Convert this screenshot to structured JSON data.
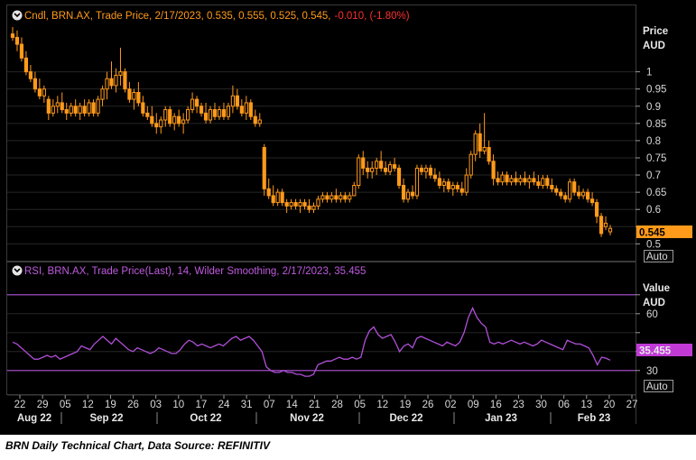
{
  "caption": "BRN Daily Technical Chart, Data Source: REFINITIV",
  "colors": {
    "background": "#000000",
    "candle": "#ff9a1a",
    "rsi_line": "#b04fd8",
    "rsi_band": "#b04fd8",
    "down_change": "#ff3030",
    "rsi_last_badge": "#c13ad6",
    "price_last_badge": "#ff9a1a",
    "grid": "#262626",
    "axis_text": "#d8d8d8"
  },
  "price_panel": {
    "legend_icon": "chart-settings-icon",
    "legend_prefix": "Cndl, BRN.AX, Trade Price, 2/17/2023, 0.535, 0.555, 0.525, 0.545,",
    "legend_change": "-0.010, (-1.80%)",
    "axis_title_1": "Price",
    "axis_title_2": "AUD",
    "last_value_label": "0.545",
    "scale_button": "Auto"
  },
  "rsi_panel": {
    "legend_icon": "chart-settings-icon",
    "legend_text": "RSI, BRN.AX, Trade Price(Last),  14, Wilder Smoothing, 2/17/2023, 35.455",
    "axis_title_1": "Value",
    "axis_title_2": "AUD",
    "last_value_label": "35.455",
    "scale_button": "Auto"
  },
  "chart_data": [
    {
      "type": "candlestick",
      "title": "Cndl, BRN.AX, Trade Price",
      "ylabel": "Price AUD",
      "ylim": [
        0.48,
        1.13
      ],
      "y_ticks": [
        0.5,
        0.55,
        0.6,
        0.65,
        0.7,
        0.75,
        0.8,
        0.85,
        0.9,
        0.95,
        1
      ],
      "y_tick_labels": [
        "0.5",
        "",
        "0.6",
        "0.65",
        "0.7",
        "0.75",
        "0.8",
        "0.85",
        "0.9",
        "0.95",
        "1"
      ],
      "last_close": 0.545,
      "x_day_ticks": [
        "22",
        "29",
        "05",
        "12",
        "19",
        "26",
        "03",
        "10",
        "17",
        "24",
        "31",
        "07",
        "14",
        "21",
        "28",
        "05",
        "12",
        "19",
        "26",
        "02",
        "09",
        "16",
        "23",
        "30",
        "06",
        "13",
        "20",
        "27"
      ],
      "x_month_labels": [
        "Aug 22",
        "Sep 22",
        "Oct 22",
        "Nov 22",
        "Dec 22",
        "Jan 23",
        "Feb 23"
      ],
      "candles": [
        {
          "o": 1.11,
          "h": 1.13,
          "l": 1.09,
          "c": 1.1
        },
        {
          "o": 1.1,
          "h": 1.12,
          "l": 1.06,
          "c": 1.08
        },
        {
          "o": 1.08,
          "h": 1.1,
          "l": 1.03,
          "c": 1.04
        },
        {
          "o": 1.04,
          "h": 1.06,
          "l": 0.99,
          "c": 1.0
        },
        {
          "o": 1.0,
          "h": 1.02,
          "l": 0.97,
          "c": 0.98
        },
        {
          "o": 0.98,
          "h": 1.0,
          "l": 0.94,
          "c": 0.95
        },
        {
          "o": 0.95,
          "h": 0.98,
          "l": 0.92,
          "c": 0.93
        },
        {
          "o": 0.93,
          "h": 0.96,
          "l": 0.91,
          "c": 0.95
        },
        {
          "o": 0.92,
          "h": 0.93,
          "l": 0.86,
          "c": 0.88
        },
        {
          "o": 0.88,
          "h": 0.92,
          "l": 0.87,
          "c": 0.9
        },
        {
          "o": 0.9,
          "h": 0.93,
          "l": 0.88,
          "c": 0.91
        },
        {
          "o": 0.91,
          "h": 0.94,
          "l": 0.88,
          "c": 0.89
        },
        {
          "o": 0.89,
          "h": 0.91,
          "l": 0.86,
          "c": 0.88
        },
        {
          "o": 0.88,
          "h": 0.91,
          "l": 0.87,
          "c": 0.9
        },
        {
          "o": 0.9,
          "h": 0.92,
          "l": 0.87,
          "c": 0.88
        },
        {
          "o": 0.88,
          "h": 0.91,
          "l": 0.86,
          "c": 0.9
        },
        {
          "o": 0.9,
          "h": 0.92,
          "l": 0.87,
          "c": 0.88
        },
        {
          "o": 0.88,
          "h": 0.92,
          "l": 0.87,
          "c": 0.91
        },
        {
          "o": 0.91,
          "h": 0.92,
          "l": 0.87,
          "c": 0.88
        },
        {
          "o": 0.88,
          "h": 0.93,
          "l": 0.87,
          "c": 0.92
        },
        {
          "o": 0.92,
          "h": 0.96,
          "l": 0.9,
          "c": 0.95
        },
        {
          "o": 0.95,
          "h": 1.0,
          "l": 0.92,
          "c": 0.98
        },
        {
          "o": 0.98,
          "h": 1.03,
          "l": 0.95,
          "c": 0.96
        },
        {
          "o": 0.96,
          "h": 1.01,
          "l": 0.94,
          "c": 0.99
        },
        {
          "o": 0.99,
          "h": 1.07,
          "l": 0.96,
          "c": 1.0
        },
        {
          "o": 1.0,
          "h": 1.01,
          "l": 0.94,
          "c": 0.95
        },
        {
          "o": 0.95,
          "h": 0.97,
          "l": 0.91,
          "c": 0.92
        },
        {
          "o": 0.92,
          "h": 0.95,
          "l": 0.89,
          "c": 0.94
        },
        {
          "o": 0.94,
          "h": 0.97,
          "l": 0.9,
          "c": 0.91
        },
        {
          "o": 0.91,
          "h": 0.93,
          "l": 0.87,
          "c": 0.88
        },
        {
          "o": 0.88,
          "h": 0.9,
          "l": 0.86,
          "c": 0.87
        },
        {
          "o": 0.87,
          "h": 0.9,
          "l": 0.84,
          "c": 0.85
        },
        {
          "o": 0.85,
          "h": 0.88,
          "l": 0.82,
          "c": 0.84
        },
        {
          "o": 0.84,
          "h": 0.87,
          "l": 0.82,
          "c": 0.86
        },
        {
          "o": 0.86,
          "h": 0.9,
          "l": 0.84,
          "c": 0.89
        },
        {
          "o": 0.89,
          "h": 0.9,
          "l": 0.84,
          "c": 0.85
        },
        {
          "o": 0.85,
          "h": 0.88,
          "l": 0.83,
          "c": 0.87
        },
        {
          "o": 0.87,
          "h": 0.89,
          "l": 0.84,
          "c": 0.85
        },
        {
          "o": 0.85,
          "h": 0.88,
          "l": 0.82,
          "c": 0.86
        },
        {
          "o": 0.86,
          "h": 0.9,
          "l": 0.85,
          "c": 0.89
        },
        {
          "o": 0.89,
          "h": 0.94,
          "l": 0.88,
          "c": 0.92
        },
        {
          "o": 0.92,
          "h": 0.93,
          "l": 0.88,
          "c": 0.9
        },
        {
          "o": 0.9,
          "h": 0.91,
          "l": 0.87,
          "c": 0.88
        },
        {
          "o": 0.88,
          "h": 0.91,
          "l": 0.85,
          "c": 0.86
        },
        {
          "o": 0.86,
          "h": 0.9,
          "l": 0.85,
          "c": 0.89
        },
        {
          "o": 0.89,
          "h": 0.91,
          "l": 0.86,
          "c": 0.87
        },
        {
          "o": 0.87,
          "h": 0.9,
          "l": 0.86,
          "c": 0.89
        },
        {
          "o": 0.89,
          "h": 0.91,
          "l": 0.86,
          "c": 0.87
        },
        {
          "o": 0.87,
          "h": 0.91,
          "l": 0.86,
          "c": 0.9
        },
        {
          "o": 0.9,
          "h": 0.96,
          "l": 0.88,
          "c": 0.93
        },
        {
          "o": 0.93,
          "h": 0.95,
          "l": 0.89,
          "c": 0.9
        },
        {
          "o": 0.9,
          "h": 0.92,
          "l": 0.87,
          "c": 0.88
        },
        {
          "o": 0.88,
          "h": 0.93,
          "l": 0.86,
          "c": 0.91
        },
        {
          "o": 0.91,
          "h": 0.92,
          "l": 0.86,
          "c": 0.87
        },
        {
          "o": 0.87,
          "h": 0.89,
          "l": 0.84,
          "c": 0.85
        },
        {
          "o": 0.85,
          "h": 0.88,
          "l": 0.84,
          "c": 0.86
        },
        {
          "o": 0.78,
          "h": 0.79,
          "l": 0.64,
          "c": 0.66
        },
        {
          "o": 0.66,
          "h": 0.69,
          "l": 0.63,
          "c": 0.64
        },
        {
          "o": 0.64,
          "h": 0.67,
          "l": 0.61,
          "c": 0.62
        },
        {
          "o": 0.62,
          "h": 0.66,
          "l": 0.61,
          "c": 0.65
        },
        {
          "o": 0.65,
          "h": 0.66,
          "l": 0.61,
          "c": 0.62
        },
        {
          "o": 0.62,
          "h": 0.63,
          "l": 0.59,
          "c": 0.61
        },
        {
          "o": 0.61,
          "h": 0.63,
          "l": 0.6,
          "c": 0.62
        },
        {
          "o": 0.62,
          "h": 0.63,
          "l": 0.6,
          "c": 0.61
        },
        {
          "o": 0.61,
          "h": 0.63,
          "l": 0.59,
          "c": 0.62
        },
        {
          "o": 0.62,
          "h": 0.63,
          "l": 0.6,
          "c": 0.61
        },
        {
          "o": 0.61,
          "h": 0.63,
          "l": 0.59,
          "c": 0.6
        },
        {
          "o": 0.6,
          "h": 0.62,
          "l": 0.59,
          "c": 0.61
        },
        {
          "o": 0.61,
          "h": 0.64,
          "l": 0.6,
          "c": 0.63
        },
        {
          "o": 0.63,
          "h": 0.65,
          "l": 0.62,
          "c": 0.64
        },
        {
          "o": 0.64,
          "h": 0.65,
          "l": 0.62,
          "c": 0.63
        },
        {
          "o": 0.63,
          "h": 0.65,
          "l": 0.62,
          "c": 0.64
        },
        {
          "o": 0.64,
          "h": 0.66,
          "l": 0.62,
          "c": 0.63
        },
        {
          "o": 0.63,
          "h": 0.65,
          "l": 0.62,
          "c": 0.64
        },
        {
          "o": 0.64,
          "h": 0.65,
          "l": 0.62,
          "c": 0.63
        },
        {
          "o": 0.63,
          "h": 0.65,
          "l": 0.62,
          "c": 0.64
        },
        {
          "o": 0.64,
          "h": 0.68,
          "l": 0.64,
          "c": 0.67
        },
        {
          "o": 0.67,
          "h": 0.76,
          "l": 0.66,
          "c": 0.75
        },
        {
          "o": 0.75,
          "h": 0.77,
          "l": 0.7,
          "c": 0.72
        },
        {
          "o": 0.72,
          "h": 0.74,
          "l": 0.69,
          "c": 0.71
        },
        {
          "o": 0.71,
          "h": 0.74,
          "l": 0.69,
          "c": 0.72
        },
        {
          "o": 0.72,
          "h": 0.75,
          "l": 0.7,
          "c": 0.74
        },
        {
          "o": 0.74,
          "h": 0.77,
          "l": 0.71,
          "c": 0.72
        },
        {
          "o": 0.72,
          "h": 0.74,
          "l": 0.7,
          "c": 0.71
        },
        {
          "o": 0.71,
          "h": 0.74,
          "l": 0.7,
          "c": 0.73
        },
        {
          "o": 0.73,
          "h": 0.75,
          "l": 0.71,
          "c": 0.72
        },
        {
          "o": 0.72,
          "h": 0.73,
          "l": 0.66,
          "c": 0.67
        },
        {
          "o": 0.67,
          "h": 0.69,
          "l": 0.62,
          "c": 0.63
        },
        {
          "o": 0.63,
          "h": 0.66,
          "l": 0.62,
          "c": 0.65
        },
        {
          "o": 0.65,
          "h": 0.67,
          "l": 0.63,
          "c": 0.64
        },
        {
          "o": 0.64,
          "h": 0.73,
          "l": 0.63,
          "c": 0.72
        },
        {
          "o": 0.72,
          "h": 0.73,
          "l": 0.7,
          "c": 0.71
        },
        {
          "o": 0.71,
          "h": 0.73,
          "l": 0.69,
          "c": 0.72
        },
        {
          "o": 0.72,
          "h": 0.73,
          "l": 0.69,
          "c": 0.7
        },
        {
          "o": 0.7,
          "h": 0.72,
          "l": 0.68,
          "c": 0.69
        },
        {
          "o": 0.69,
          "h": 0.71,
          "l": 0.66,
          "c": 0.67
        },
        {
          "o": 0.67,
          "h": 0.69,
          "l": 0.65,
          "c": 0.68
        },
        {
          "o": 0.68,
          "h": 0.69,
          "l": 0.65,
          "c": 0.66
        },
        {
          "o": 0.66,
          "h": 0.68,
          "l": 0.64,
          "c": 0.67
        },
        {
          "o": 0.67,
          "h": 0.68,
          "l": 0.65,
          "c": 0.66
        },
        {
          "o": 0.66,
          "h": 0.68,
          "l": 0.64,
          "c": 0.65
        },
        {
          "o": 0.65,
          "h": 0.72,
          "l": 0.64,
          "c": 0.7
        },
        {
          "o": 0.7,
          "h": 0.77,
          "l": 0.69,
          "c": 0.76
        },
        {
          "o": 0.76,
          "h": 0.83,
          "l": 0.74,
          "c": 0.82
        },
        {
          "o": 0.82,
          "h": 0.85,
          "l": 0.75,
          "c": 0.77
        },
        {
          "o": 0.77,
          "h": 0.88,
          "l": 0.76,
          "c": 0.78
        },
        {
          "o": 0.78,
          "h": 0.8,
          "l": 0.73,
          "c": 0.74
        },
        {
          "o": 0.74,
          "h": 0.76,
          "l": 0.67,
          "c": 0.69
        },
        {
          "o": 0.69,
          "h": 0.71,
          "l": 0.67,
          "c": 0.68
        },
        {
          "o": 0.68,
          "h": 0.71,
          "l": 0.67,
          "c": 0.7
        },
        {
          "o": 0.7,
          "h": 0.71,
          "l": 0.67,
          "c": 0.68
        },
        {
          "o": 0.68,
          "h": 0.7,
          "l": 0.67,
          "c": 0.69
        },
        {
          "o": 0.69,
          "h": 0.71,
          "l": 0.67,
          "c": 0.68
        },
        {
          "o": 0.68,
          "h": 0.7,
          "l": 0.67,
          "c": 0.69
        },
        {
          "o": 0.69,
          "h": 0.71,
          "l": 0.67,
          "c": 0.68
        },
        {
          "o": 0.68,
          "h": 0.7,
          "l": 0.66,
          "c": 0.69
        },
        {
          "o": 0.69,
          "h": 0.71,
          "l": 0.67,
          "c": 0.68
        },
        {
          "o": 0.68,
          "h": 0.7,
          "l": 0.66,
          "c": 0.67
        },
        {
          "o": 0.67,
          "h": 0.7,
          "l": 0.66,
          "c": 0.69
        },
        {
          "o": 0.69,
          "h": 0.7,
          "l": 0.66,
          "c": 0.67
        },
        {
          "o": 0.67,
          "h": 0.69,
          "l": 0.65,
          "c": 0.66
        },
        {
          "o": 0.66,
          "h": 0.67,
          "l": 0.64,
          "c": 0.65
        },
        {
          "o": 0.65,
          "h": 0.66,
          "l": 0.63,
          "c": 0.64
        },
        {
          "o": 0.64,
          "h": 0.65,
          "l": 0.62,
          "c": 0.63
        },
        {
          "o": 0.63,
          "h": 0.69,
          "l": 0.62,
          "c": 0.68
        },
        {
          "o": 0.68,
          "h": 0.69,
          "l": 0.64,
          "c": 0.65
        },
        {
          "o": 0.65,
          "h": 0.67,
          "l": 0.63,
          "c": 0.64
        },
        {
          "o": 0.64,
          "h": 0.66,
          "l": 0.63,
          "c": 0.65
        },
        {
          "o": 0.65,
          "h": 0.66,
          "l": 0.62,
          "c": 0.63
        },
        {
          "o": 0.63,
          "h": 0.65,
          "l": 0.61,
          "c": 0.62
        },
        {
          "o": 0.62,
          "h": 0.63,
          "l": 0.56,
          "c": 0.58
        },
        {
          "o": 0.58,
          "h": 0.59,
          "l": 0.52,
          "c": 0.53
        },
        {
          "o": 0.55,
          "h": 0.58,
          "l": 0.54,
          "c": 0.56
        },
        {
          "o": 0.535,
          "h": 0.555,
          "l": 0.525,
          "c": 0.545
        }
      ]
    },
    {
      "type": "line",
      "title": "RSI, BRN.AX, Trade Price(Last), 14, Wilder Smoothing",
      "ylabel": "Value AUD",
      "ylim": [
        18,
        78
      ],
      "y_ticks": [
        30,
        40,
        50,
        60,
        70
      ],
      "y_tick_labels": [
        "30",
        "",
        "",
        "60",
        ""
      ],
      "bands": [
        70,
        30
      ],
      "last_value": 35.455,
      "series": [
        {
          "name": "RSI",
          "values": [
            45,
            44,
            42,
            40,
            38,
            36,
            36,
            37,
            38,
            37,
            38,
            36,
            37,
            38,
            39,
            40,
            43,
            42,
            41,
            44,
            46,
            48,
            46,
            44,
            47,
            45,
            43,
            41,
            40,
            42,
            41,
            40,
            39,
            40,
            42,
            41,
            40,
            39,
            39,
            41,
            44,
            46,
            45,
            43,
            44,
            43,
            42,
            43,
            44,
            43,
            45,
            47,
            48,
            46,
            47,
            48,
            46,
            43,
            40,
            32,
            30,
            29,
            29,
            30,
            29,
            29,
            28,
            28,
            27,
            27,
            28,
            33,
            34,
            35,
            35,
            36,
            37,
            36,
            36,
            37,
            36,
            37,
            46,
            51,
            53,
            49,
            47,
            48,
            49,
            45,
            40,
            43,
            44,
            42,
            47,
            48,
            47,
            46,
            45,
            44,
            43,
            45,
            44,
            43,
            45,
            50,
            58,
            63,
            58,
            55,
            53,
            45,
            44,
            45,
            44,
            45,
            46,
            45,
            44,
            45,
            44,
            43,
            44,
            46,
            45,
            44,
            43,
            42,
            41,
            46,
            45,
            44,
            44,
            43,
            42,
            38,
            33,
            37,
            36.5,
            35.455
          ]
        }
      ]
    }
  ]
}
